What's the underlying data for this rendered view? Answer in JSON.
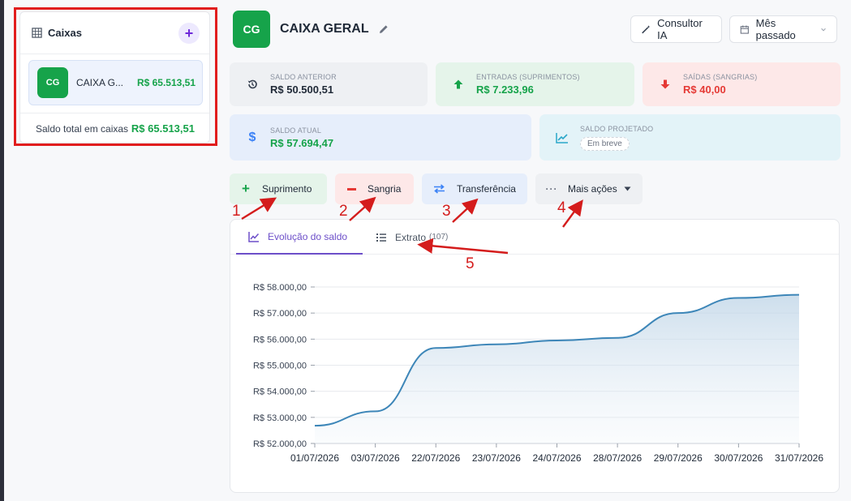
{
  "sidebar": {
    "title": "Caixas",
    "add_label": "+",
    "item": {
      "initials": "CG",
      "name": "CAIXA G...",
      "value": "R$ 65.513,51"
    },
    "total_label": "Saldo total em caixas",
    "total_value": "R$ 65.513,51"
  },
  "header": {
    "initials": "CG",
    "title": "CAIXA GERAL",
    "consultor_label": "Consultor IA",
    "period_label": "Mês passado"
  },
  "stats": {
    "saldo_anterior": {
      "label": "SALDO ANTERIOR",
      "value": "R$ 50.500,51"
    },
    "entradas": {
      "label": "ENTRADAS (SUPRIMENTOS)",
      "value": "R$ 7.233,96"
    },
    "saidas": {
      "label": "SAÍDAS (SANGRIAS)",
      "value": "R$ 40,00"
    },
    "saldo_atual": {
      "label": "SALDO ATUAL",
      "value": "R$ 57.694,47"
    },
    "saldo_projetado": {
      "label": "SALDO PROJETADO",
      "badge": "Em breve"
    }
  },
  "actions": {
    "suprimento": "Suprimento",
    "sangria": "Sangria",
    "transferencia": "Transferência",
    "mais_acoes": "Mais ações"
  },
  "tabs": {
    "evolucao": "Evolução do saldo",
    "extrato": "Extrato",
    "extrato_count": "(107)"
  },
  "annotations": [
    "1",
    "2",
    "3",
    "4",
    "5"
  ],
  "colors": {
    "green": "#16a34a",
    "red": "#e53935",
    "blue": "#3b82f6",
    "purple": "#6d4fc9",
    "line": "#3d86b8",
    "annotation": "#d41c1c"
  },
  "chart_data": {
    "type": "area",
    "x": [
      "01/07/2026",
      "03/07/2026",
      "22/07/2026",
      "23/07/2026",
      "24/07/2026",
      "28/07/2026",
      "29/07/2026",
      "30/07/2026",
      "31/07/2026"
    ],
    "y_tick_labels": [
      "R$ 52.000,00",
      "R$ 53.000,00",
      "R$ 54.000,00",
      "R$ 55.000,00",
      "R$ 56.000,00",
      "R$ 57.000,00",
      "R$ 58.000,00"
    ],
    "ylim": [
      52000,
      58000
    ],
    "series": [
      {
        "values": [
          52680,
          53230,
          55660,
          55800,
          55950,
          56050,
          57000,
          57580,
          57700
        ]
      }
    ]
  }
}
